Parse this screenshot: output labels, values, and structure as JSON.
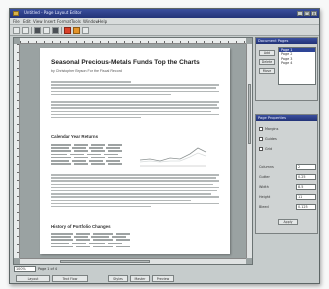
{
  "window": {
    "title": "Untitled - Page Layout Editor"
  },
  "menubar": {
    "items": [
      "File",
      "Edit",
      "View",
      "Insert",
      "Format",
      "Tools",
      "Window",
      "Help"
    ]
  },
  "document": {
    "headline": "Seasonal Precious-Metals Funds Top the Charts",
    "byline": "by Christopher Bryson  For the Fiscal Record",
    "section1_heading": "Calendar Year Returns",
    "section2_heading": "History of Portfolio Changes"
  },
  "side_panel": {
    "pages_title": "Document Pages",
    "buttons": [
      "Add",
      "Delete",
      "Move"
    ],
    "pages": [
      "Page 1",
      "Page 2",
      "Page 3",
      "Page 4"
    ],
    "selected_page_index": 0,
    "properties_title": "Page Properties",
    "options": [
      "Margins",
      "Guides",
      "Grid"
    ],
    "field_labels": [
      "Columns",
      "Gutter",
      "Width",
      "Height",
      "Bleed"
    ],
    "field_values": [
      "2",
      "0.25",
      "8.5",
      "11",
      "0.125"
    ],
    "apply_button": "Apply"
  },
  "statusbar": {
    "zoom_value": "100%",
    "zoom_label": "Page 1 of 4",
    "tabs": [
      "Layout",
      "Text Flow",
      "Styles",
      "Master",
      "Preview"
    ]
  },
  "colors": {
    "titlebar": "#223377",
    "chart_line_1": "#8c9292",
    "chart_line_2": "#d8dcdc"
  }
}
